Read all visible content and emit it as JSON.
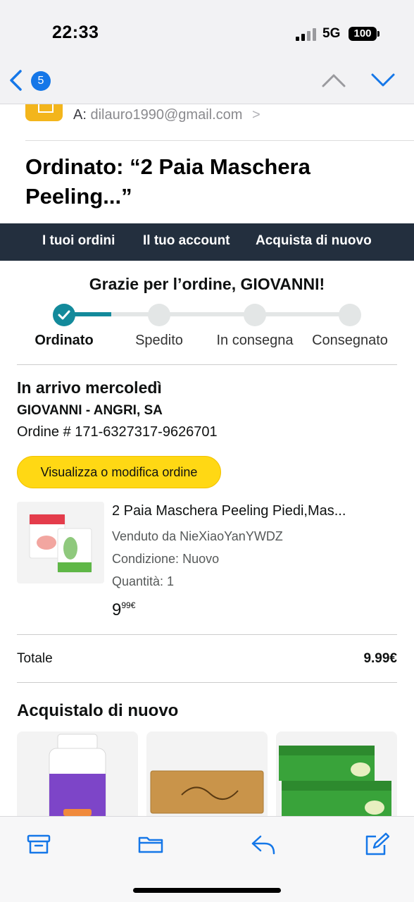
{
  "status_bar": {
    "time": "22:33",
    "network": "5G",
    "battery": "100"
  },
  "mail_nav": {
    "unread_count": "5"
  },
  "header": {
    "to_label": "A:",
    "to_address": "dilauro1990@gmail.com",
    "to_chevron": ">",
    "subject": "Ordinato: “2 Paia Maschera Peeling...”"
  },
  "amazon_nav": {
    "orders": "I tuoi ordini",
    "account": "Il tuo account",
    "buy_again": "Acquista di nuovo"
  },
  "order": {
    "thanks": "Grazie per l’ordine, GIOVANNI!",
    "steps": [
      {
        "label": "Ordinato"
      },
      {
        "label": "Spedito"
      },
      {
        "label": "In consegna"
      },
      {
        "label": "Consegnato"
      }
    ],
    "arrival": "In arrivo mercoledì",
    "ship_to": "GIOVANNI - ANGRI, SA",
    "order_number": "Ordine # 171-6327317-9626701",
    "view_button": "Visualizza o modifica ordine"
  },
  "product": {
    "title": "2 Paia Maschera Peeling Piedi,Mas...",
    "seller": "Venduto da NieXiaoYanYWDZ",
    "condition": "Condizione: Nuovo",
    "quantity": "Quantità: 1",
    "price_whole": "9",
    "price_fraction": "99€"
  },
  "totals": {
    "label": "Totale",
    "value": "9.99€"
  },
  "buy_again": {
    "title": "Acquistalo di nuovo"
  },
  "colors": {
    "amazon_nav_bg": "#232f3e",
    "progress": "#138a9b",
    "button": "#ffd814",
    "ios_blue": "#1577e8"
  }
}
